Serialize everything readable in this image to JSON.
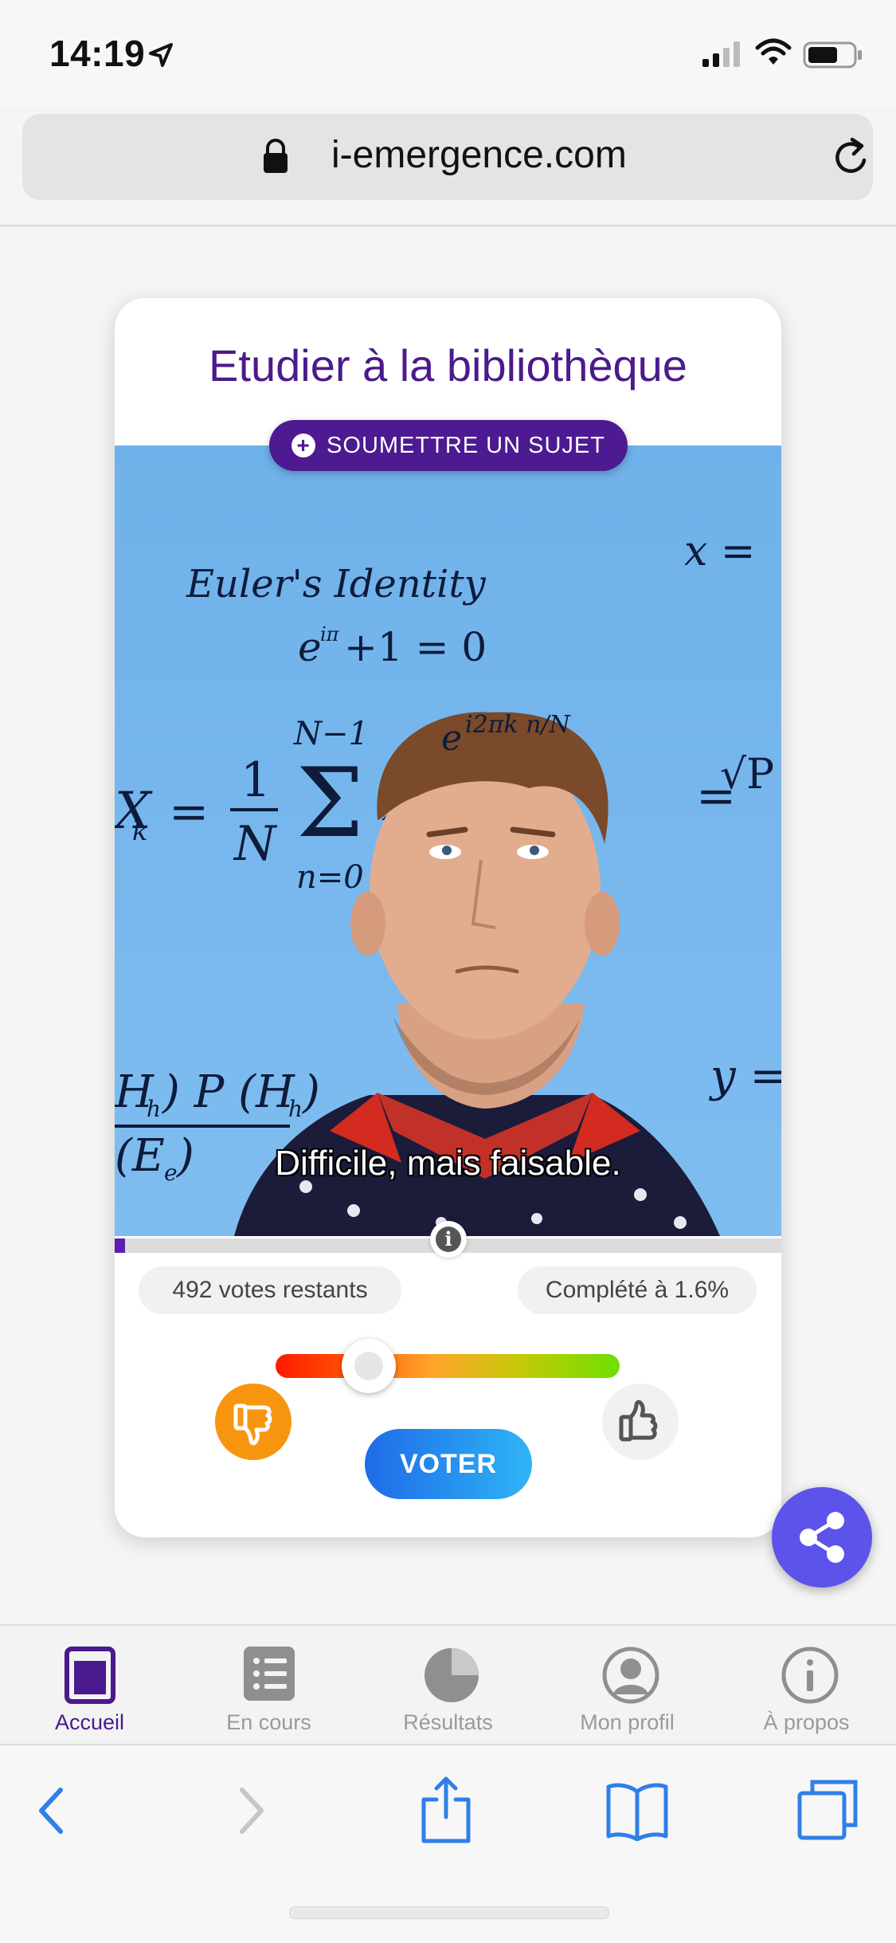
{
  "status_bar": {
    "time": "14:19"
  },
  "browser": {
    "url": "i-emergence.com"
  },
  "card": {
    "title": "Etudier à la bibliothèque",
    "submit_label": "SOUMETTRE UN SUJET",
    "media_subtitle": "Difficile, mais faisable.",
    "media_caption": "Euler's Identity",
    "progress_fraction": 0.016,
    "votes_remaining": "492 votes restants",
    "completion": "Complété à 1.6%",
    "slider_fraction": 0.27,
    "vote_label": "VOTER"
  },
  "tabs": [
    {
      "label": "Accueil",
      "active": true
    },
    {
      "label": "En cours",
      "active": false
    },
    {
      "label": "Résultats",
      "active": false
    },
    {
      "label": "Mon profil",
      "active": false
    },
    {
      "label": "À propos",
      "active": false
    }
  ],
  "colors": {
    "primary": "#4b1a8c",
    "fab": "#5b53ea",
    "dislike": "#f7960e",
    "vote_start": "#1f6be8",
    "vote_end": "#2fb4f5"
  }
}
